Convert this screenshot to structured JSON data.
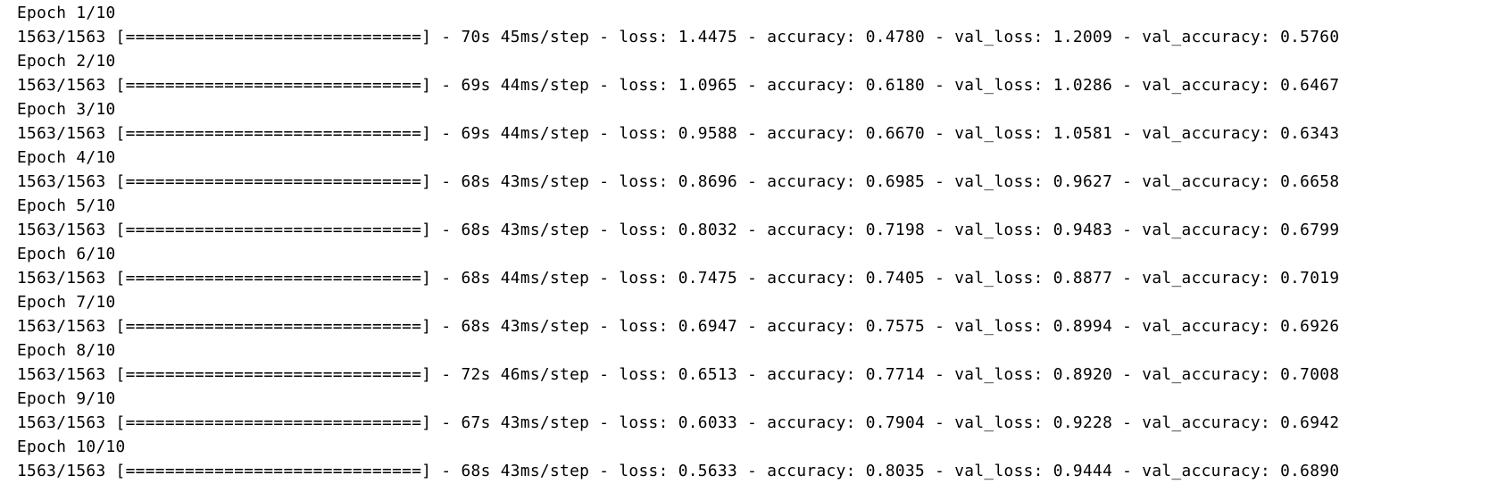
{
  "training_log": {
    "epochs": [
      {
        "header": "Epoch 1/10",
        "progress": "1563/1563 [==============================] - 70s 45ms/step - loss: 1.4475 - accuracy: 0.4780 - val_loss: 1.2009 - val_accuracy: 0.5760"
      },
      {
        "header": "Epoch 2/10",
        "progress": "1563/1563 [==============================] - 69s 44ms/step - loss: 1.0965 - accuracy: 0.6180 - val_loss: 1.0286 - val_accuracy: 0.6467"
      },
      {
        "header": "Epoch 3/10",
        "progress": "1563/1563 [==============================] - 69s 44ms/step - loss: 0.9588 - accuracy: 0.6670 - val_loss: 1.0581 - val_accuracy: 0.6343"
      },
      {
        "header": "Epoch 4/10",
        "progress": "1563/1563 [==============================] - 68s 43ms/step - loss: 0.8696 - accuracy: 0.6985 - val_loss: 0.9627 - val_accuracy: 0.6658"
      },
      {
        "header": "Epoch 5/10",
        "progress": "1563/1563 [==============================] - 68s 43ms/step - loss: 0.8032 - accuracy: 0.7198 - val_loss: 0.9483 - val_accuracy: 0.6799"
      },
      {
        "header": "Epoch 6/10",
        "progress": "1563/1563 [==============================] - 68s 44ms/step - loss: 0.7475 - accuracy: 0.7405 - val_loss: 0.8877 - val_accuracy: 0.7019"
      },
      {
        "header": "Epoch 7/10",
        "progress": "1563/1563 [==============================] - 68s 43ms/step - loss: 0.6947 - accuracy: 0.7575 - val_loss: 0.8994 - val_accuracy: 0.6926"
      },
      {
        "header": "Epoch 8/10",
        "progress": "1563/1563 [==============================] - 72s 46ms/step - loss: 0.6513 - accuracy: 0.7714 - val_loss: 0.8920 - val_accuracy: 0.7008"
      },
      {
        "header": "Epoch 9/10",
        "progress": "1563/1563 [==============================] - 67s 43ms/step - loss: 0.6033 - accuracy: 0.7904 - val_loss: 0.9228 - val_accuracy: 0.6942"
      },
      {
        "header": "Epoch 10/10",
        "progress": "1563/1563 [==============================] - 68s 43ms/step - loss: 0.5633 - accuracy: 0.8035 - val_loss: 0.9444 - val_accuracy: 0.6890"
      }
    ]
  }
}
